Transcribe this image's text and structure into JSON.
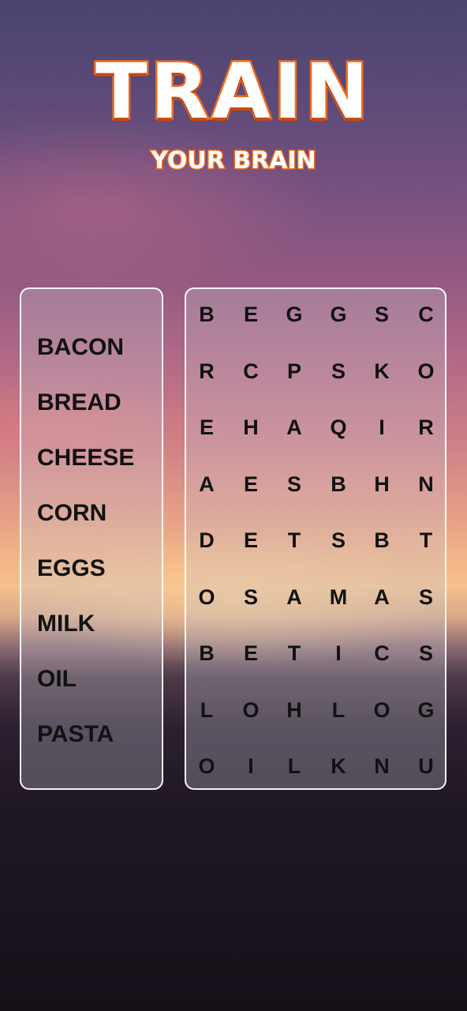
{
  "header": {
    "title": "TRAIN",
    "subtitle": "YOUR BRAIN"
  },
  "words": [
    "BACON",
    "BREAD",
    "CHEESE",
    "CORN",
    "EGGS",
    "MILK",
    "OIL",
    "PASTA"
  ],
  "grid": [
    [
      "B",
      "E",
      "G",
      "G",
      "S",
      "C"
    ],
    [
      "R",
      "C",
      "P",
      "S",
      "K",
      "O"
    ],
    [
      "E",
      "H",
      "A",
      "Q",
      "I",
      "R"
    ],
    [
      "A",
      "E",
      "S",
      "B",
      "H",
      "N"
    ],
    [
      "D",
      "E",
      "T",
      "S",
      "B",
      "T"
    ],
    [
      "O",
      "S",
      "A",
      "M",
      "A",
      "S"
    ],
    [
      "B",
      "E",
      "T",
      "I",
      "C",
      "S"
    ],
    [
      "L",
      "O",
      "H",
      "L",
      "O",
      "G"
    ],
    [
      "O",
      "I",
      "L",
      "K",
      "N",
      "U"
    ]
  ],
  "colors": {
    "title_outline": "#f26a1b",
    "panel_border": "#ffffff",
    "text": "#111111"
  }
}
